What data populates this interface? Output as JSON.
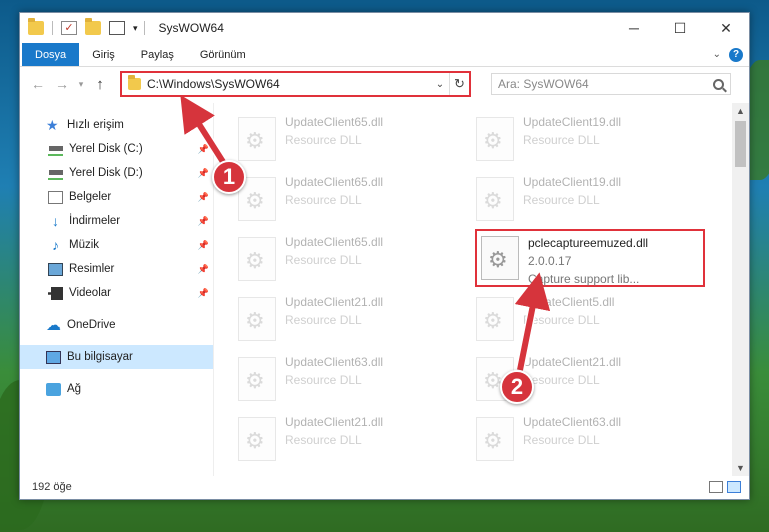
{
  "window": {
    "title": "SysWOW64",
    "controls": {
      "minimize": "─",
      "maximize": "☐",
      "close": "✕"
    }
  },
  "ribbon": {
    "tabs": [
      "Dosya",
      "Giriş",
      "Paylaş",
      "Görünüm"
    ],
    "expand_icon": "chevron-down",
    "help": "?"
  },
  "address": {
    "path": "C:\\Windows\\SysWOW64",
    "search_placeholder": "Ara: SysWOW64"
  },
  "nav": {
    "items": [
      {
        "label": "Hızlı erişim",
        "icon": "star-icon"
      },
      {
        "label": "Yerel Disk (C:)",
        "icon": "drive-icon",
        "pinned": true
      },
      {
        "label": "Yerel Disk (D:)",
        "icon": "drive-icon",
        "pinned": true
      },
      {
        "label": "Belgeler",
        "icon": "documents-icon",
        "pinned": true
      },
      {
        "label": "İndirmeler",
        "icon": "downloads-icon",
        "pinned": true
      },
      {
        "label": "Müzik",
        "icon": "music-icon",
        "pinned": true
      },
      {
        "label": "Resimler",
        "icon": "pictures-icon",
        "pinned": true
      },
      {
        "label": "Videolar",
        "icon": "videos-icon",
        "pinned": true
      },
      {
        "label": "OneDrive",
        "icon": "onedrive-icon"
      },
      {
        "label": "Bu bilgisayar",
        "icon": "this-pc-icon",
        "selected": true
      },
      {
        "label": "Ağ",
        "icon": "network-icon"
      }
    ]
  },
  "files": {
    "col1": [
      {
        "name": "UpdateClient65.dll",
        "sub": "Resource DLL"
      },
      {
        "name": "UpdateClient65.dll",
        "sub": "Resource DLL"
      },
      {
        "name": "UpdateClient65.dll",
        "sub": "Resource DLL"
      },
      {
        "name": "UpdateClient21.dll",
        "sub": "Resource DLL"
      },
      {
        "name": "UpdateClient63.dll",
        "sub": "Resource DLL"
      },
      {
        "name": "UpdateClient21.dll",
        "sub": "Resource DLL"
      }
    ],
    "col2": [
      {
        "name": "UpdateClient19.dll",
        "sub": "Resource DLL"
      },
      {
        "name": "UpdateClient19.dll",
        "sub": "Resource DLL"
      },
      {
        "name": "UpdateClient5.dll",
        "sub": "Resource DLL"
      },
      {
        "name": "UpdateClient21.dll",
        "sub": "Resource DLL"
      },
      {
        "name": "UpdateClient63.dll",
        "sub": "Resource DLL"
      }
    ],
    "highlight": {
      "name": "pclecaptureemuzed.dll",
      "version": "2.0.0.17",
      "desc": "Capture support lib..."
    }
  },
  "status": {
    "count": "192 öğe"
  },
  "callouts": {
    "one": "1",
    "two": "2"
  },
  "colors": {
    "accent": "#1979ca",
    "callout": "#d6343c",
    "highlight_border": "#e0313a"
  }
}
